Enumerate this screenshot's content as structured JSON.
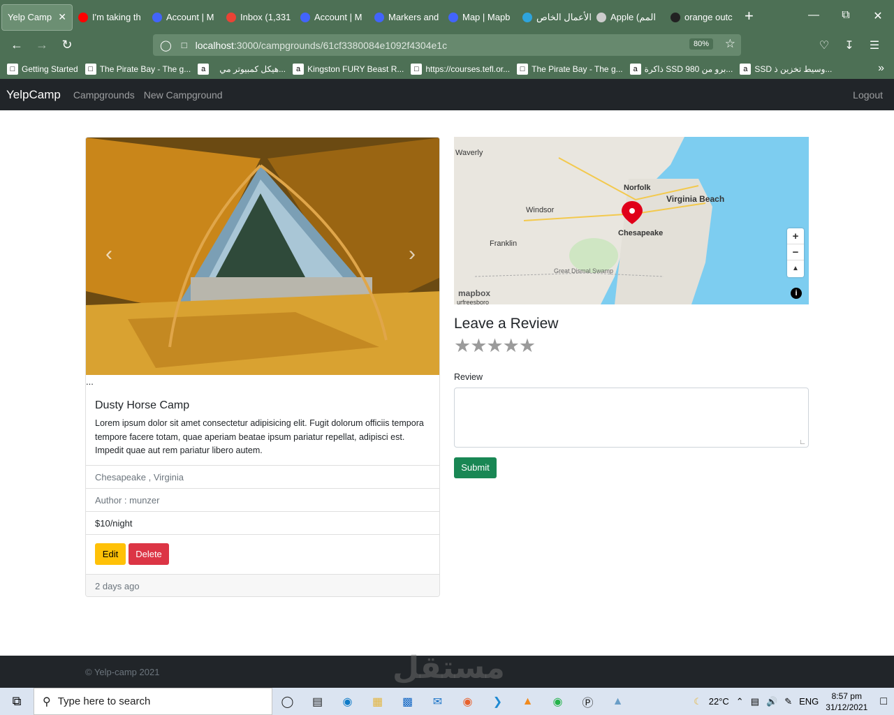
{
  "browser": {
    "tabs": [
      {
        "label": "Yelp Camp",
        "active": true,
        "favicon": "yelpcamp-icon",
        "color": "#8aa690"
      },
      {
        "label": "I'm taking th",
        "favicon": "youtube-icon",
        "color": "#ff0000"
      },
      {
        "label": "Account | M",
        "favicon": "mapbox-icon",
        "color": "#4264fb"
      },
      {
        "label": "Inbox (1,331",
        "favicon": "gmail-icon",
        "color": "#ea4335"
      },
      {
        "label": "Account | M",
        "favicon": "mapbox-icon",
        "color": "#4264fb"
      },
      {
        "label": "Markers and",
        "favicon": "mapbox-icon",
        "color": "#4264fb"
      },
      {
        "label": "Map | Mapb",
        "favicon": "mapbox-icon",
        "color": "#4264fb"
      },
      {
        "label": "الأعمال الخاص",
        "favicon": "mostaql-icon",
        "color": "#2ea4dd"
      },
      {
        "label": "Apple (المم",
        "favicon": "apple-icon",
        "color": "#cccccc"
      },
      {
        "label": "orange outc",
        "favicon": "page-icon",
        "color": "#222222"
      }
    ],
    "url_host": "localhost",
    "url_path": ":3000/campgrounds/61cf3380084e1092f4304e1c",
    "zoom": "80%",
    "bookmarks": [
      {
        "label": "Getting Started",
        "icon": "firefox-icon"
      },
      {
        "label": "The Pirate Bay - The g...",
        "icon": "pirate-icon"
      },
      {
        "label": "",
        "icon": "amazon-icon"
      },
      {
        "label": "هيكل كمبيوتر مي...",
        "icon": ""
      },
      {
        "label": "Kingston FURY Beast R...",
        "icon": "amazon-icon"
      },
      {
        "label": "https://courses.tefl.or...",
        "icon": "page-icon"
      },
      {
        "label": "The Pirate Bay - The g...",
        "icon": "pirate-icon"
      },
      {
        "label": "ذاكرة SSD 980 برو من...",
        "icon": "amazon-icon"
      },
      {
        "label": "SSD وسيط تخزين ذ...",
        "icon": "amazon-icon"
      }
    ]
  },
  "app": {
    "brand": "YelpCamp",
    "nav_campgrounds": "Campgrounds",
    "nav_new": "New Campground",
    "nav_logout": "Logout"
  },
  "campground": {
    "ellipsis": "...",
    "title": "Dusty Horse Camp",
    "description": "Lorem ipsum dolor sit amet consectetur adipisicing elit. Fugit dolorum officiis tempora tempore facere totam, quae aperiam beatae ipsum pariatur repellat, adipisci est. Impedit quae aut rem pariatur libero autem.",
    "location": "Chesapeake , Virginia",
    "author": "Author : munzer",
    "price": "$10/night",
    "edit_label": "Edit",
    "delete_label": "Delete",
    "posted": "2 days ago"
  },
  "map": {
    "labels": [
      "Waverly",
      "Norfolk",
      "Virginia Beach",
      "Windsor",
      "Chesapeake",
      "Franklin",
      "Great Dismal Swamp",
      "urfreesboro"
    ],
    "logo": "mapbox",
    "zoom_in": "+",
    "zoom_out": "−",
    "compass": "▲",
    "info": "i"
  },
  "review": {
    "heading": "Leave a Review",
    "stars": "★★★★★",
    "label": "Review",
    "submit": "Submit"
  },
  "footer": {
    "text": "© Yelp-camp 2021",
    "watermark": "مستقل"
  },
  "taskbar": {
    "search_placeholder": "Type here to search",
    "temp": "22°C",
    "lang": "ENG",
    "time": "8:57 pm",
    "date": "31/12/2021"
  }
}
